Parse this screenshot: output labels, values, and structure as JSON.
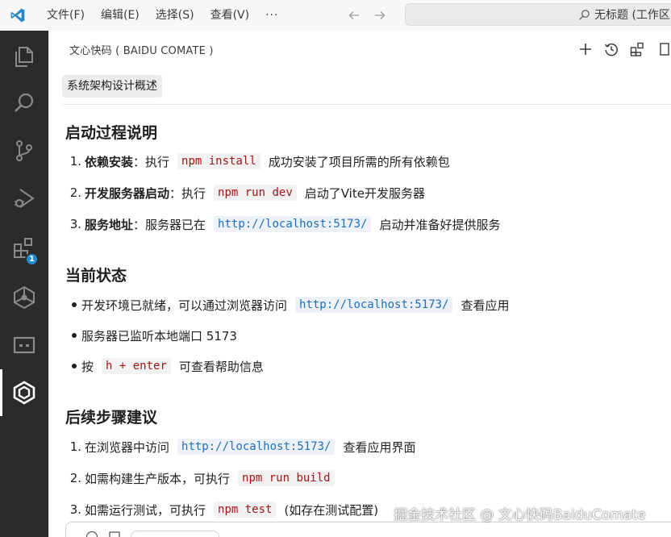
{
  "titlebar": {
    "menus": [
      "文件(F)",
      "编辑(E)",
      "选择(S)",
      "查看(V)",
      "···"
    ],
    "command_center": "无标题 (工作区)"
  },
  "activitybar": {
    "items": [
      "explorer-icon",
      "search-icon",
      "source-control-icon",
      "run-debug-icon",
      "extensions-icon",
      "comate-agent-icon",
      "remote-icon",
      "comate-icon"
    ],
    "extensions_badge": "1"
  },
  "panel": {
    "title": "文心快码 ( BAIDU COMATE )",
    "actions": [
      "add-icon",
      "history-icon",
      "layout-icon",
      "more-icon"
    ],
    "chat_title": "系统架构设计概述"
  },
  "sections": [
    {
      "title": "启动过程说明",
      "items": [
        {
          "marker": "1.",
          "strong": "依赖安装",
          "pre": "：执行",
          "code": "npm install",
          "post": "成功安装了项目所需的所有依赖包"
        },
        {
          "marker": "2.",
          "strong": "开发服务器启动",
          "pre": "：执行",
          "code": "npm run dev",
          "post": "启动了Vite开发服务器"
        },
        {
          "marker": "3.",
          "strong": "服务地址",
          "pre": "：服务器已在",
          "code": "http://localhost:5173/",
          "post": "启动并准备好提供服务"
        }
      ]
    },
    {
      "title": "当前状态",
      "items": [
        {
          "pre": "开发环境已就绪，可以通过浏览器访问",
          "code": "http://localhost:5173/",
          "post": "查看应用"
        },
        {
          "pre": "服务器已监听本地端口 5173"
        },
        {
          "pre": "按",
          "code": "h + enter",
          "post": "可查看帮助信息"
        }
      ]
    },
    {
      "title": "后续步骤建议",
      "items": [
        {
          "marker": "1.",
          "pre": "在浏览器中访问",
          "code": "http://localhost:5173/",
          "post": "查看应用界面"
        },
        {
          "marker": "2.",
          "pre": "如需构建生产版本，可执行",
          "code": "npm run build"
        },
        {
          "marker": "3.",
          "pre": "如需运行测试，可执行",
          "code": "npm test",
          "post": "(如存在测试配置)"
        }
      ]
    }
  ],
  "watermark": "掘金技术社区 @ 文心快码BaiduComate",
  "colors": {
    "activitybar_bg": "#2b2b2b",
    "accent": "#1f8ad2",
    "code_text": "#a31515",
    "link_code_text": "#1c6fbf"
  }
}
